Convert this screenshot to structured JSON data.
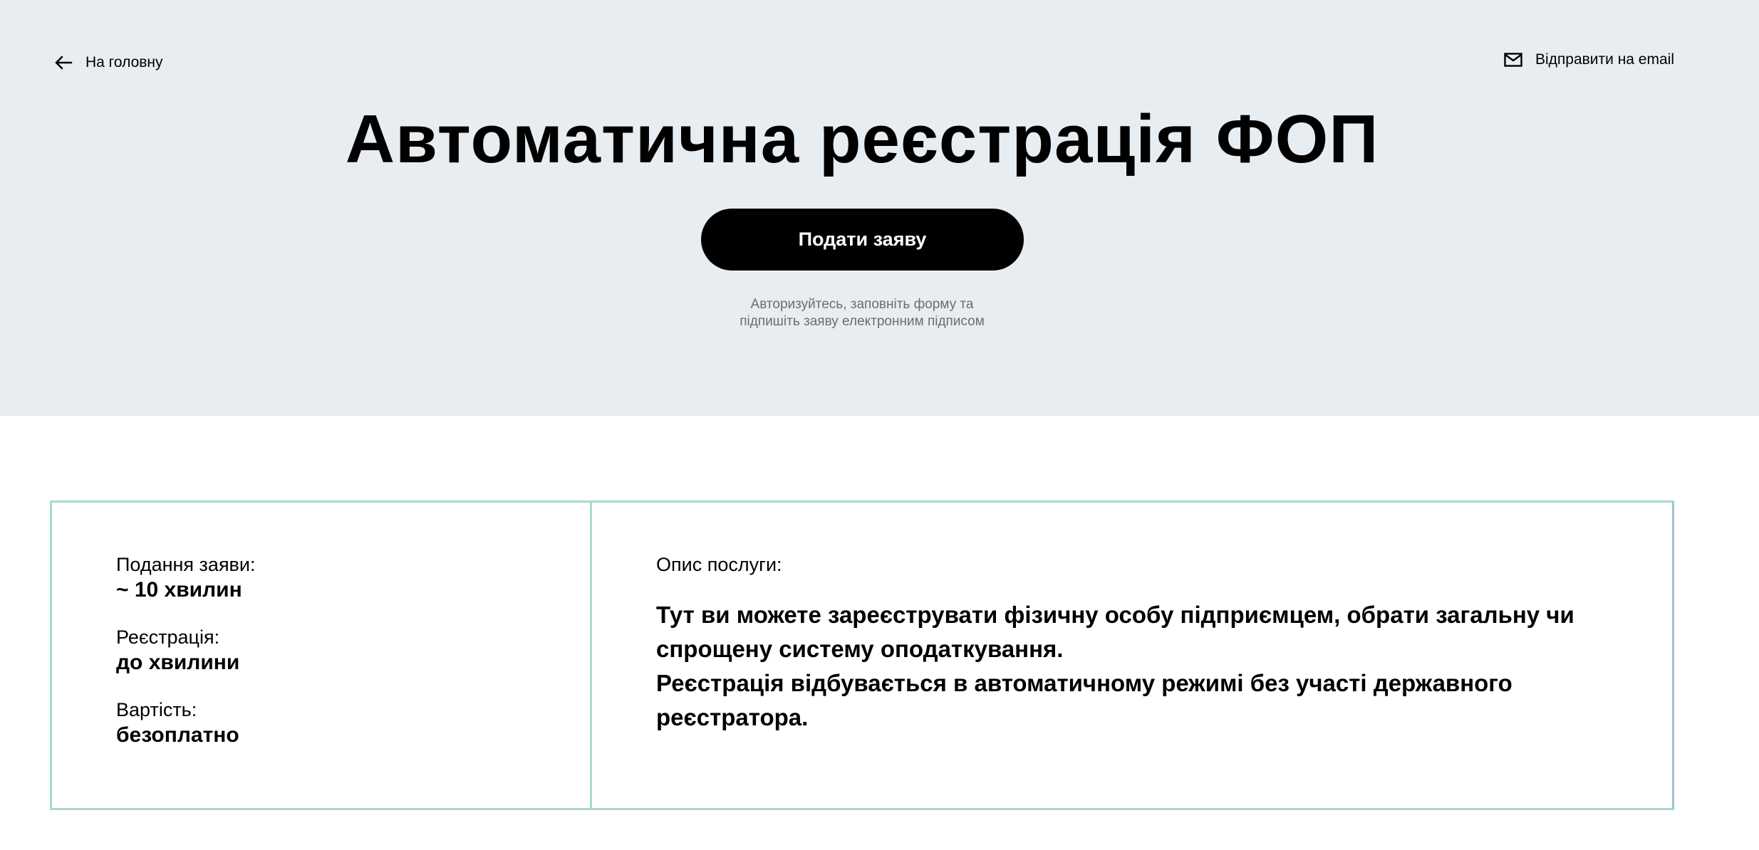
{
  "header": {
    "back_label": "На головну",
    "email_label": "Відправити на email"
  },
  "hero": {
    "title": "Автоматична реєстрація ФОП",
    "cta_label": "Подати заяву",
    "hint_line1": "Авторизуйтесь, заповніть форму та",
    "hint_line2": "підпишіть заяву електронним підписом"
  },
  "info": {
    "items": [
      {
        "label": "Подання заяви:",
        "value": "~ 10 хвилин"
      },
      {
        "label": "Реєстрація:",
        "value": "до хвилини"
      },
      {
        "label": "Вартість:",
        "value": "безоплатно"
      }
    ],
    "description_label": "Опис послуги:",
    "description_line1": "Тут ви можете зареєструвати фізичну особу підприємцем, обрати загальну чи спрощену систему оподаткування.",
    "description_line2": "Реєстрація відбувається в автоматичному режимі без участі державного реєстратора."
  },
  "icons": {
    "back": "arrow-left-icon",
    "email": "envelope-icon"
  },
  "colors": {
    "hero_background": "#e8edf2",
    "cta_background": "#000000",
    "card_border": "#a9d9d0",
    "hint_text": "#6a6e73"
  }
}
